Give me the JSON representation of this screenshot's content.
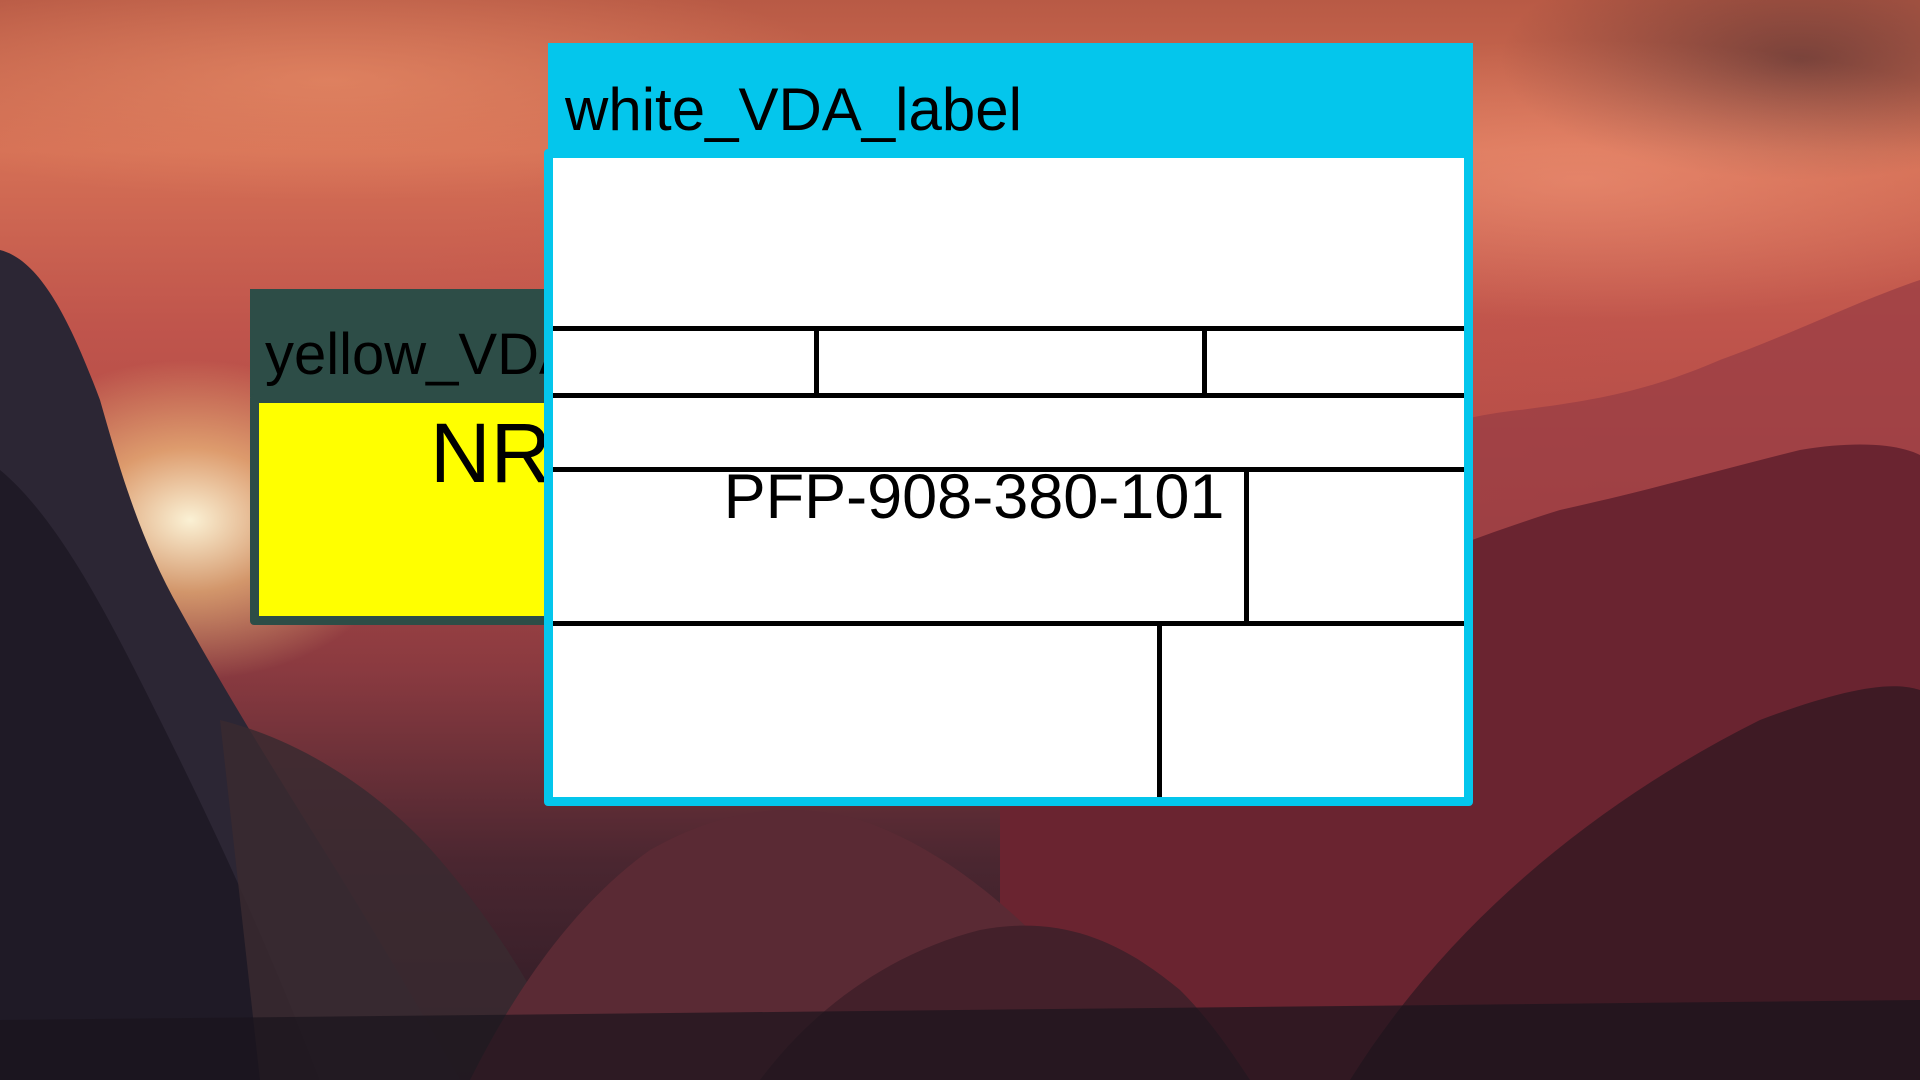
{
  "desktop": {
    "wallpaper": "sunset-mountain-valley"
  },
  "windows": {
    "yellow": {
      "title": "yellow_VDA_label",
      "body_text": "NR",
      "titlebar_color": "#2d4d47",
      "body_color": "#ffff00"
    },
    "white": {
      "title": "white_VDA_label",
      "part_number": "PFP-908-380-101",
      "titlebar_color": "#04c6ec",
      "body_color": "#ffffff"
    }
  }
}
